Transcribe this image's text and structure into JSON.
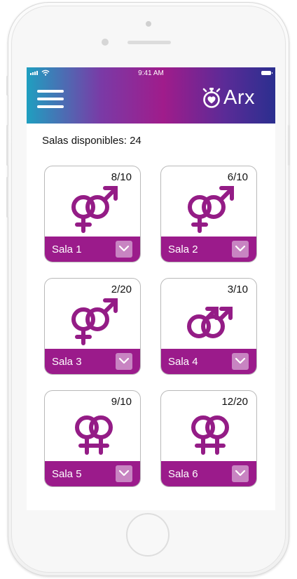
{
  "status_bar": {
    "time": "9:41 AM"
  },
  "header": {
    "logo_text": "Arx",
    "accent_color": "#9b1b8b"
  },
  "salas": {
    "label": "Salas disponibles: 24"
  },
  "rooms": [
    {
      "name": "Sala 1",
      "count": "8/10",
      "symbol": "mixed-gender-icon"
    },
    {
      "name": "Sala 2",
      "count": "6/10",
      "symbol": "mixed-gender-icon"
    },
    {
      "name": "Sala 3",
      "count": "2/20",
      "symbol": "mixed-gender-icon"
    },
    {
      "name": "Sala 4",
      "count": "3/10",
      "symbol": "male-pair-icon"
    },
    {
      "name": "Sala 5",
      "count": "9/10",
      "symbol": "female-pair-icon"
    },
    {
      "name": "Sala 6",
      "count": "12/20",
      "symbol": "female-pair-icon"
    }
  ]
}
